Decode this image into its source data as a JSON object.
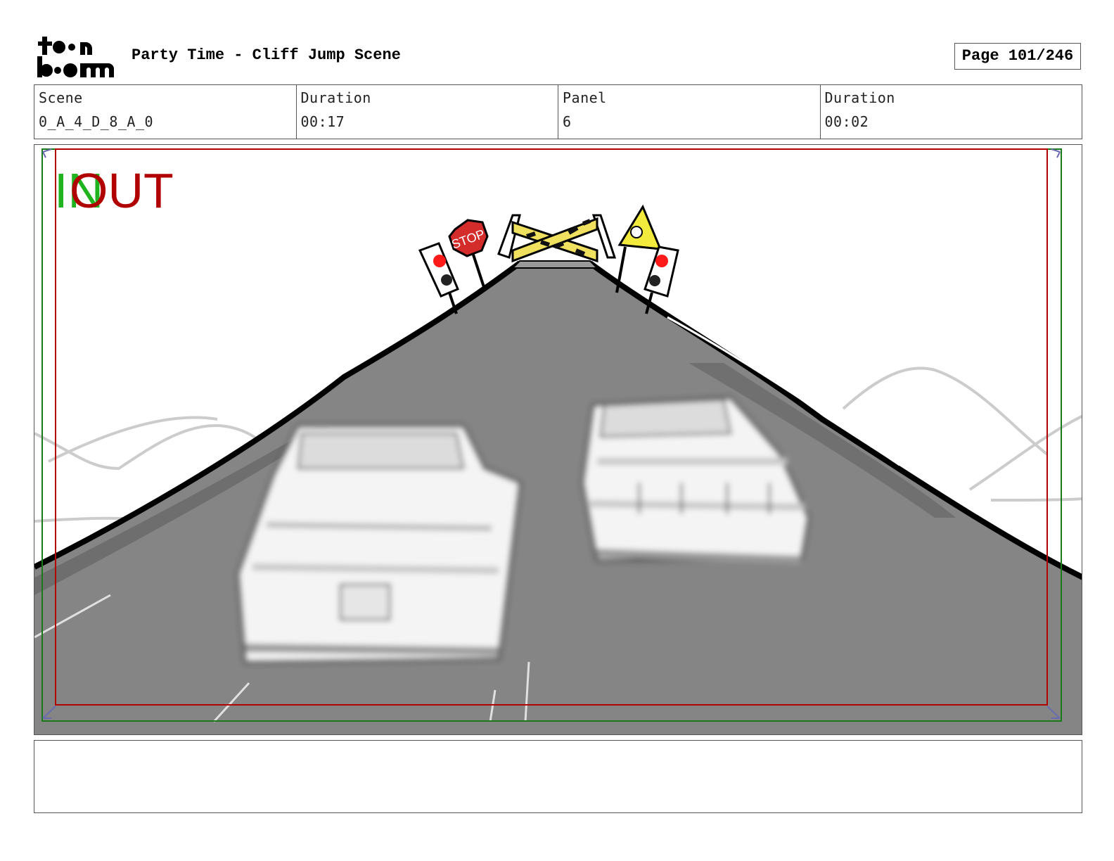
{
  "header": {
    "logo_text": "toon boom",
    "title": "Party Time - Cliff Jump Scene",
    "page": "Page 101/246"
  },
  "info": [
    {
      "label": "Scene",
      "value": "0_A_4_D_8_A_0"
    },
    {
      "label": "Duration",
      "value": "00:17"
    },
    {
      "label": "Panel",
      "value": "6"
    },
    {
      "label": "Duration",
      "value": "00:02"
    }
  ],
  "panel": {
    "in_label": "IN",
    "out_label": "OUT",
    "sign_text": "STOP",
    "colors": {
      "road": "#858585",
      "safe_frame": "#b00000",
      "action_frame": "#1a7a1a",
      "in": "#1fb31f",
      "out": "#b00000",
      "stop_sign": "#d42b2b",
      "warning_sign": "#f2ea3c",
      "signal_light": "#ff1a1a"
    }
  },
  "notes": {
    "text": ""
  }
}
